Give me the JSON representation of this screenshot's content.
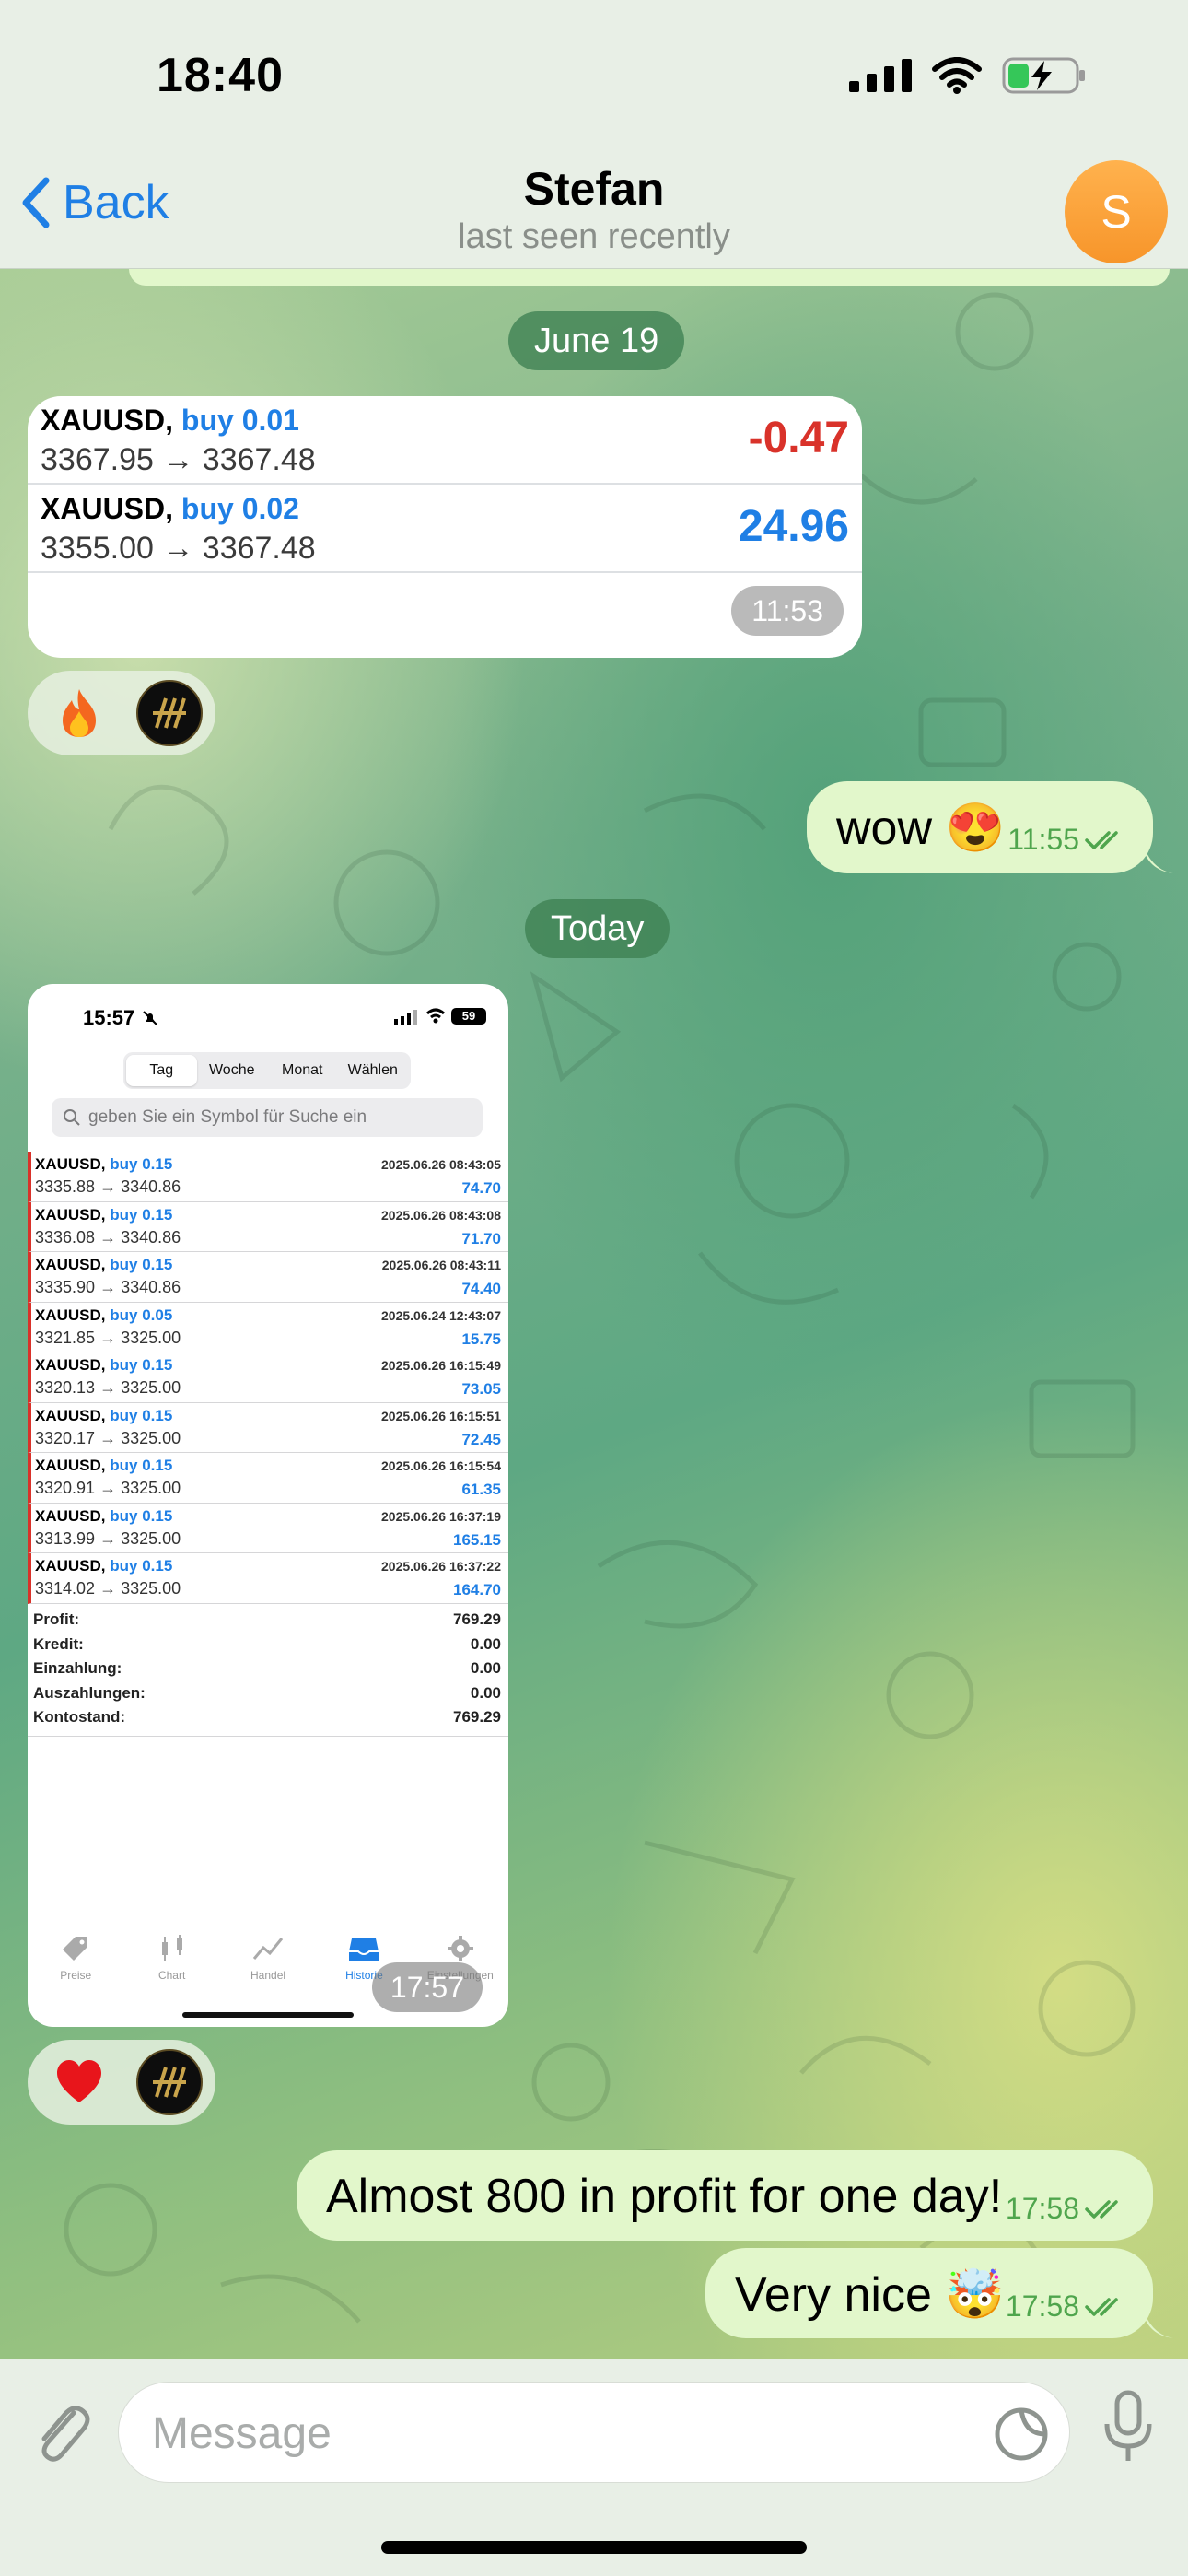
{
  "status_bar": {
    "time": "18:40"
  },
  "header": {
    "back_label": "Back",
    "title": "Stefan",
    "subtitle": "last seen recently",
    "avatar_initial": "S"
  },
  "dates": {
    "first": "June 19",
    "second": "Today"
  },
  "trade_card": {
    "rows": [
      {
        "symbol": "XAUUSD,",
        "action": "buy 0.01",
        "prices": "3367.95 → 3367.48",
        "pl": "-0.47"
      },
      {
        "symbol": "XAUUSD,",
        "action": "buy 0.02",
        "prices": "3355.00 → 3367.48",
        "pl": "24.96"
      }
    ],
    "time": "11:53"
  },
  "reactions": {
    "first": "fire-emoji",
    "second": "heart-emoji"
  },
  "messages": {
    "wow": {
      "text": "wow 😍",
      "time": "11:55"
    },
    "profit": {
      "text": "Almost 800 in profit for one day!",
      "time": "17:58"
    },
    "nice": {
      "text": "Very nice 🤯",
      "time": "17:58"
    }
  },
  "screenshot": {
    "time": "15:57",
    "battery": "59",
    "segments": [
      "Tag",
      "Woche",
      "Monat",
      "Wählen"
    ],
    "search_placeholder": "geben Sie ein Symbol für Suche ein",
    "history": [
      {
        "symbol": "XAUUSD,",
        "action": "buy 0.15",
        "prices": "3335.88 → 3340.86",
        "date": "2025.06.26 08:43:05",
        "value": "74.70"
      },
      {
        "symbol": "XAUUSD,",
        "action": "buy 0.15",
        "prices": "3336.08 → 3340.86",
        "date": "2025.06.26 08:43:08",
        "value": "71.70"
      },
      {
        "symbol": "XAUUSD,",
        "action": "buy 0.15",
        "prices": "3335.90 → 3340.86",
        "date": "2025.06.26 08:43:11",
        "value": "74.40"
      },
      {
        "symbol": "XAUUSD,",
        "action": "buy 0.05",
        "prices": "3321.85 → 3325.00",
        "date": "2025.06.24 12:43:07",
        "value": "15.75"
      },
      {
        "symbol": "XAUUSD,",
        "action": "buy 0.15",
        "prices": "3320.13 → 3325.00",
        "date": "2025.06.26 16:15:49",
        "value": "73.05"
      },
      {
        "symbol": "XAUUSD,",
        "action": "buy 0.15",
        "prices": "3320.17 → 3325.00",
        "date": "2025.06.26 16:15:51",
        "value": "72.45"
      },
      {
        "symbol": "XAUUSD,",
        "action": "buy 0.15",
        "prices": "3320.91 → 3325.00",
        "date": "2025.06.26 16:15:54",
        "value": "61.35"
      },
      {
        "symbol": "XAUUSD,",
        "action": "buy 0.15",
        "prices": "3313.99 → 3325.00",
        "date": "2025.06.26 16:37:19",
        "value": "165.15"
      },
      {
        "symbol": "XAUUSD,",
        "action": "buy 0.15",
        "prices": "3314.02 → 3325.00",
        "date": "2025.06.26 16:37:22",
        "value": "164.70"
      }
    ],
    "summary": [
      {
        "label": "Profit:",
        "value": "769.29"
      },
      {
        "label": "Kredit:",
        "value": "0.00"
      },
      {
        "label": "Einzahlung:",
        "value": "0.00"
      },
      {
        "label": "Auszahlungen:",
        "value": "0.00"
      },
      {
        "label": "Kontostand:",
        "value": "769.29"
      }
    ],
    "tabs": [
      "Preise",
      "Chart",
      "Handel",
      "Historie",
      "Einstellungen"
    ],
    "image_time": "17:57"
  },
  "composer": {
    "placeholder": "Message"
  },
  "colors": {
    "accent": "#1f7fe5",
    "outgoing_bubble": "#e2f7cb",
    "loss": "#d9322a",
    "read_check": "#4fa54d"
  }
}
